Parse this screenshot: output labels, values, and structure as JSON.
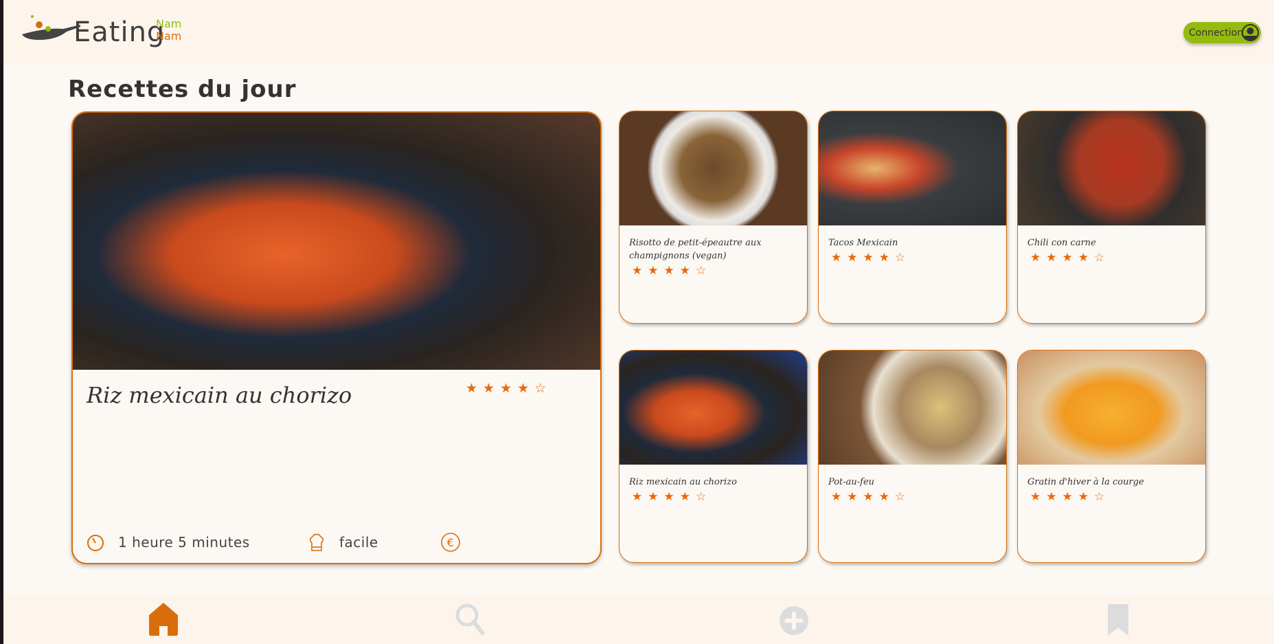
{
  "header": {
    "logo_main": "Eating",
    "logo_nam1": "Nam",
    "logo_nam2": "Nam",
    "connection_label": "Connection"
  },
  "page_title": "Recettes du jour",
  "featured": {
    "name": "Riz mexicain au chorizo",
    "rating": 4,
    "max_rating": 5,
    "duration": "1 heure 5 minutes",
    "difficulty": "facile"
  },
  "recipes": [
    {
      "name": "Risotto de petit-épeautre aux champignons (vegan)",
      "rating": 4
    },
    {
      "name": "Tacos Mexicain",
      "rating": 4
    },
    {
      "name": "Chili con carne",
      "rating": 4
    },
    {
      "name": "Riz mexicain au chorizo",
      "rating": 4
    },
    {
      "name": "Pot-au-feu",
      "rating": 4
    },
    {
      "name": "Gratin d'hiver à la courge",
      "rating": 4
    }
  ],
  "nav": [
    "home-icon",
    "search-icon",
    "add-icon",
    "bookmark-icon"
  ],
  "colors": {
    "accent": "#d96d0b",
    "green": "#96bb10",
    "nav_inactive": "#dcdcdc"
  }
}
